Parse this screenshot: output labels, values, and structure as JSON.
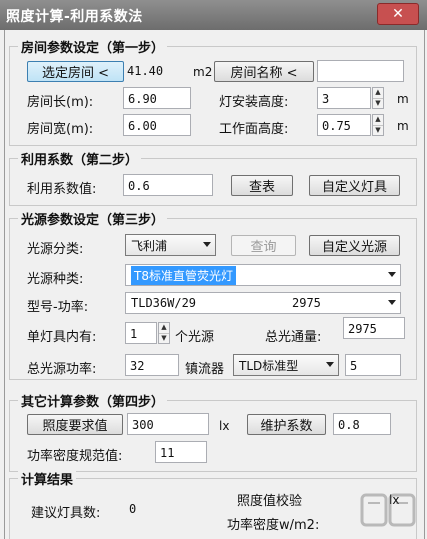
{
  "window": {
    "title": "照度计算-利用系数法",
    "close": "✕"
  },
  "step1": {
    "title": "房间参数设定（第一步）",
    "select_room_btn": "选定房间 <",
    "area_value": "41.40",
    "area_unit": "m2",
    "room_name_btn": "房间名称 <",
    "room_name_value": "",
    "length_label": "房间长(m):",
    "length_value": "6.90",
    "width_label": "房间宽(m):",
    "width_value": "6.00",
    "lamp_height_label": "灯安装高度:",
    "lamp_height_value": "3",
    "lamp_height_unit": "m",
    "work_height_label": "工作面高度:",
    "work_height_value": "0.75",
    "work_height_unit": "m"
  },
  "step2": {
    "title": "利用系数（第二步）",
    "coef_label": "利用系数值:",
    "coef_value": "0.6",
    "lookup_btn": "查表",
    "custom_lamp_btn": "自定义灯具"
  },
  "step3": {
    "title": "光源参数设定（第三步）",
    "category_label": "光源分类:",
    "category_value": "飞利浦",
    "query_btn": "查询",
    "custom_source_btn": "自定义光源",
    "type_label": "光源种类:",
    "type_value": "T8标准直管荧光灯",
    "model_label": "型号-功率:",
    "model_value": "TLD36W/29",
    "model_flux": "2975",
    "per_lamp_label": "单灯具内有:",
    "per_lamp_value": "1",
    "per_lamp_suffix": "个光源",
    "total_flux_label": "总光通量:",
    "total_flux_value": "2975",
    "total_power_label": "总光源功率:",
    "total_power_value": "32",
    "ballast_label": "镇流器",
    "ballast_value": "TLD标准型",
    "ballast_power": "5"
  },
  "step4": {
    "title": "其它计算参数（第四步）",
    "illum_req_btn": "照度要求值",
    "illum_req_value": "300",
    "illum_unit": "lx",
    "maint_btn": "维护系数",
    "maint_value": "0.8",
    "density_label": "功率密度规范值:",
    "density_value": "11"
  },
  "result": {
    "title": "计算结果",
    "lamp_count_label": "建议灯具数:",
    "lamp_count_value": "0",
    "illum_check_label": "照度值校验",
    "illum_check_unit": "lx",
    "density_check_label": "功率密度w/m2:"
  },
  "colors": {
    "titlebar": "#7a7a7a",
    "close": "#c75050",
    "selection": "#3399ff"
  }
}
